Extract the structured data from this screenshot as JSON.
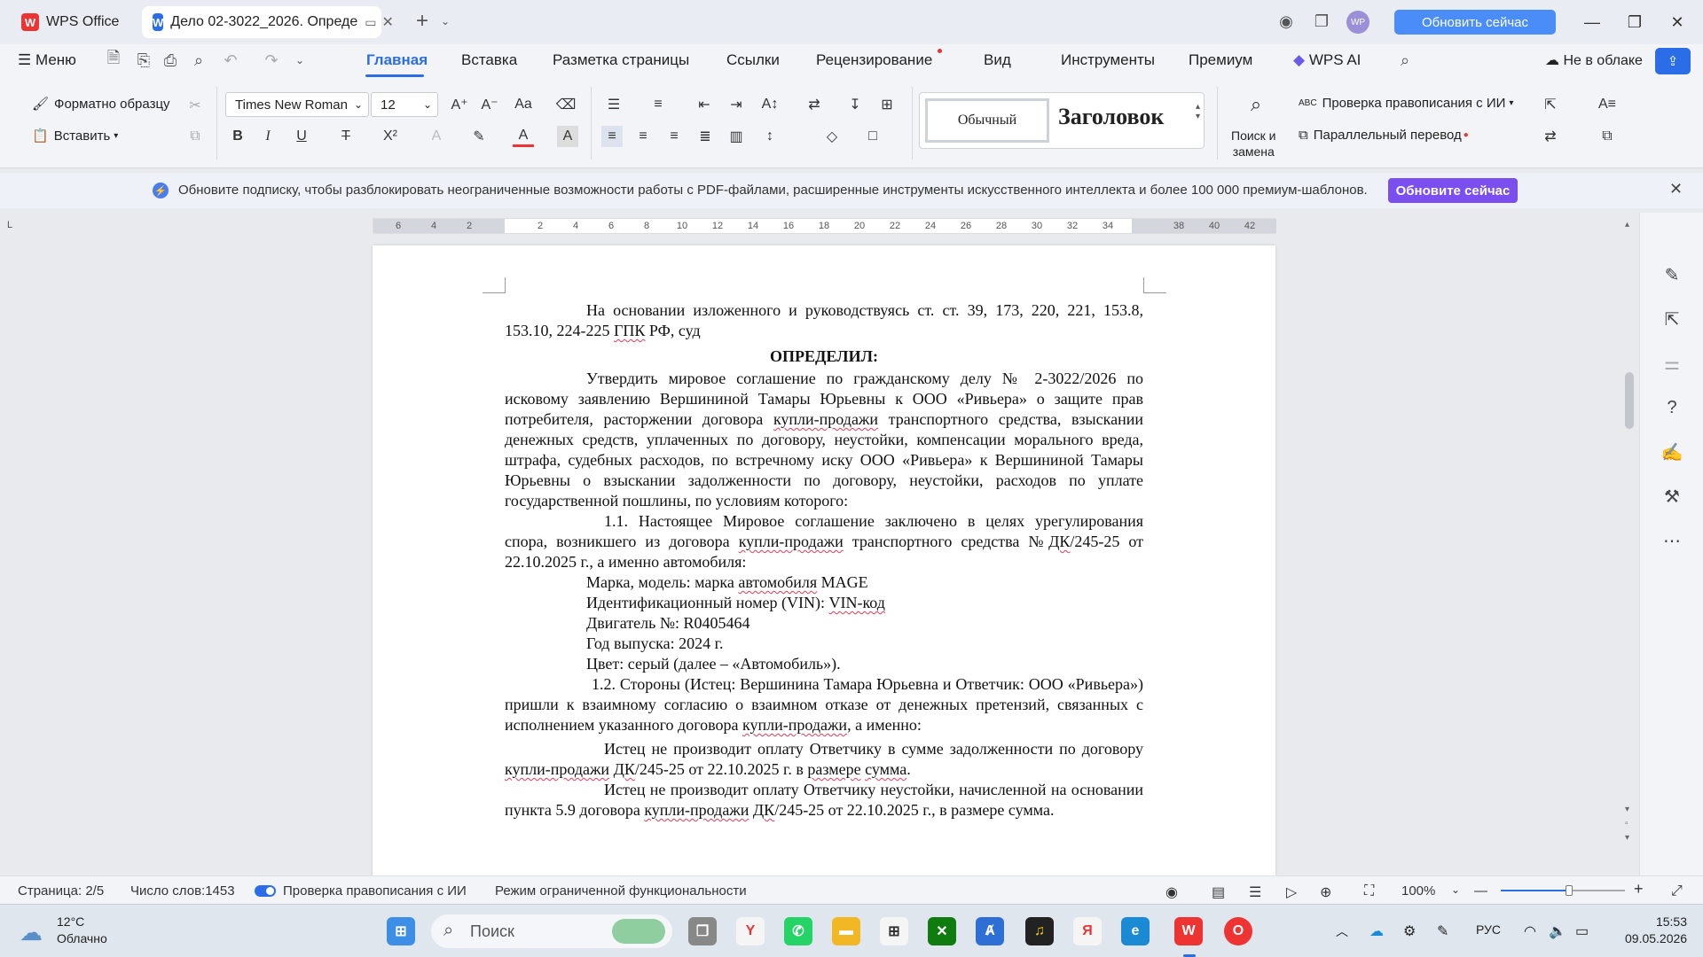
{
  "titlebar": {
    "tab_wps": "WPS Office",
    "tab_doc": "Дело 02-3022_2026. Опреде",
    "upgrade_button": "Обновить сейчас",
    "avatar_initials": "WP"
  },
  "menu": {
    "menu_label": "Меню",
    "items": [
      "Главная",
      "Вставка",
      "Разметка страницы",
      "Ссылки",
      "Рецензирование",
      "Вид",
      "Инструменты",
      "Премиум",
      "WPS AI"
    ],
    "active": "Главная",
    "cloud_label": "Не в облаке"
  },
  "ribbon": {
    "format_painter": "Форматно образцу",
    "paste": "Вставить",
    "font_name": "Times New Roman",
    "font_size": "12",
    "style_normal": "Обычный",
    "style_heading": "Заголовок",
    "find_replace_1": "Поиск и",
    "find_replace_2": "замена",
    "spellcheck": "Проверка правописания с ИИ",
    "parallel_translate": "Параллельный перевод"
  },
  "notification": {
    "text": "Обновите подписку, чтобы разблокировать неограниченные возможности работы с PDF-файлами, расширенные инструменты искусственного интеллекта и более 100 000 премиум-шаблонов.",
    "button": "Обновите сейчас"
  },
  "ruler": {
    "ticks": [
      "6",
      "4",
      "2",
      "2",
      "4",
      "6",
      "8",
      "10",
      "12",
      "14",
      "16",
      "18",
      "20",
      "22",
      "24",
      "26",
      "28",
      "30",
      "32",
      "34",
      "38",
      "40",
      "42"
    ]
  },
  "document": {
    "p1": "На основании изложенного и руководствуясь ст. ст. 39, 173, 220, 221, 153.8, 153.10, 224-225 ",
    "p1_u": "ГПК",
    "p1_end": " РФ, суд",
    "heading": "ОПРЕДЕЛИЛ:",
    "p2a": "Утвердить мировое соглашение по гражданскому делу № 2-3022/2026 по исковому заявлению Вершининой Тамары Юрьевны к ООО «Ривьера» о защите прав потребителя, расторжении договора ",
    "p2_u": "купли-продажи",
    "p2b": " транспортного средства, взыскании денежных средств, уплаченных по договору, неустойки, компенсации морального вреда, штрафа, судебных расходов, по встречному иску ООО «Ривьера» к Вершининой Тамары Юрьевны о взыскании задолженности по договору, неустойки, расходов по уплате государственной пошлины, по условиям которого:",
    "p3a": "1.1. Настоящее Мировое соглашение заключено в целях урегулирования спора, возникшего из договора ",
    "p3_u1": "купли-продажи",
    "p3b": " транспортного средства №",
    "p3_u2": "ДК",
    "p3c": "/245-25 от 22.10.2025 г., а именно автомобиля:",
    "l1a": "Марка, модель: марка ",
    "l1_u": "автомобиля",
    "l1b": " MAGE",
    "l2a": "Идентификационный номер (VIN): ",
    "l2_u": "VIN-код",
    "l3": "Двигатель №: R0405464",
    "l4": "Год выпуска: 2024 г.",
    "l5": "Цвет: серый (далее – «Автомобиль»).",
    "p4a": "1.2. Стороны (Истец: Вершинина Тамара Юрьевна и Ответчик: ООО «Ривьера») пришли к взаимному согласию о взаимном отказе от денежных претензий, связанных с исполнением указанного договора ",
    "p4_u": "купли-продажи",
    "p4b": ", а именно:",
    "p5a": "Истец не производит оплату Ответчику в сумме задолженности по договору ",
    "p5_u1": "купли-продажи",
    "p5b": " ",
    "p5_u2": "ДК",
    "p5c": "/245-25 от 22.10.2025 г. в ",
    "p5_u3": "размере",
    "p5d": " ",
    "p5_u4": "сумма",
    "p5e": ".",
    "p6a": "Истец не производит оплату Ответчику неустойки, начисленной на основании пункта 5.9 договора ",
    "p6_u1": "купли-продажи",
    "p6b": " ",
    "p6_u2": "ДК",
    "p6c": "/245-25 от 22.10.2025 г., в размере сумма."
  },
  "statusbar": {
    "page": "Страница: 2/5",
    "words": "Число слов:1453",
    "spellcheck": "Проверка правописания с ИИ",
    "mode": "Режим ограниченной функциональности",
    "zoom": "100%",
    "zoom_level": 0.55
  },
  "taskbar": {
    "weather_temp": "12°C",
    "weather_desc": "Облачно",
    "search_placeholder": "Поиск",
    "lang": "РУС",
    "time": "15:53",
    "date": "09.05.2026"
  }
}
